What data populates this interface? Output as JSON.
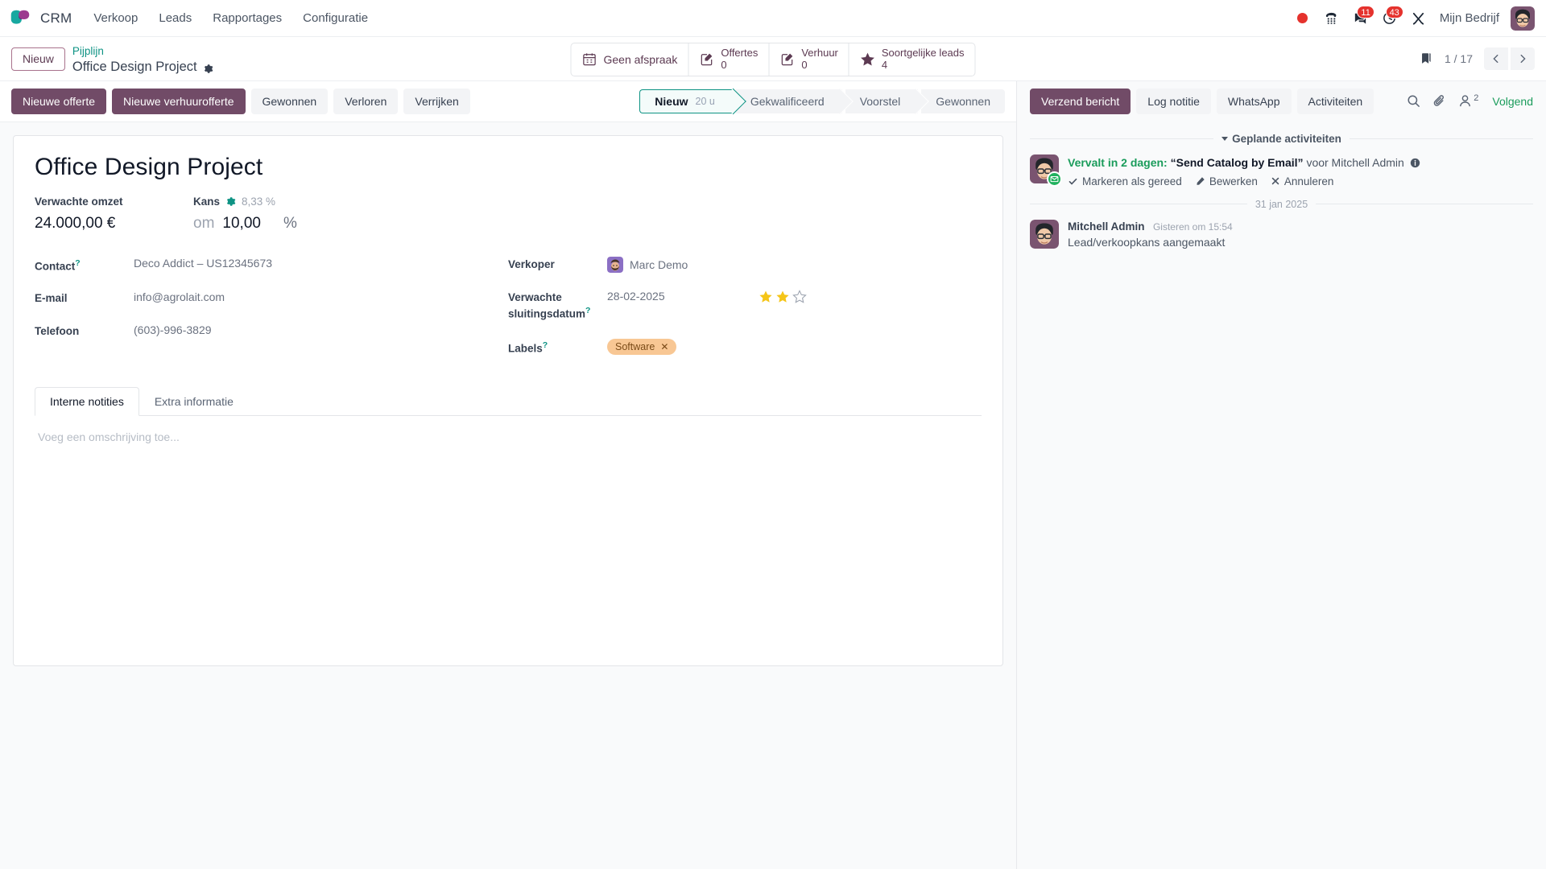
{
  "navbar": {
    "app_name": "CRM",
    "menus": [
      "Verkoop",
      "Leads",
      "Rapportages",
      "Configuratie"
    ],
    "icons": [
      "record-dot-icon",
      "phone-dialpad-icon",
      "messages-icon",
      "activities-clock-icon",
      "tools-icon"
    ],
    "messages_badge": "11",
    "activities_badge": "43",
    "company": "Mijn Bedrijf"
  },
  "control_panel": {
    "new_button": "Nieuw",
    "breadcrumb_parent": "Pijplijn",
    "breadcrumb_current": "Office Design Project",
    "stat_buttons": [
      {
        "icon": "calendar-icon",
        "label": "Geen afspraak",
        "value": ""
      },
      {
        "icon": "quotation-icon",
        "label": "Offertes",
        "value": "0"
      },
      {
        "icon": "rental-icon",
        "label": "Verhuur",
        "value": "0"
      },
      {
        "icon": "star-icon",
        "label": "Soortgelijke leads",
        "value": "4"
      }
    ],
    "pager": "1 / 17"
  },
  "form_header": {
    "buttons": [
      {
        "label": "Nieuwe offerte",
        "style": "primary"
      },
      {
        "label": "Nieuwe verhuurofferte",
        "style": "primary"
      },
      {
        "label": "Gewonnen",
        "style": "secondary"
      },
      {
        "label": "Verloren",
        "style": "secondary"
      },
      {
        "label": "Verrijken",
        "style": "secondary"
      }
    ],
    "stages": [
      {
        "label": "Nieuw",
        "extra": "20 u",
        "active": true
      },
      {
        "label": "Gekwalificeerd",
        "extra": "",
        "active": false
      },
      {
        "label": "Voorstel",
        "extra": "",
        "active": false
      },
      {
        "label": "Gewonnen",
        "extra": "",
        "active": false
      }
    ]
  },
  "record": {
    "title": "Office Design Project",
    "revenue_label": "Verwachte omzet",
    "revenue_value": "24.000,00 €",
    "probability_label": "Kans",
    "probability_auto": "8,33 %",
    "probability_at": "om",
    "probability_value": "10,00",
    "probability_unit": "%",
    "left_fields": [
      {
        "label": "Contact",
        "help": "?",
        "value": "Deco Addict – US12345673"
      },
      {
        "label": "E-mail",
        "help": "",
        "value": "info@agrolait.com"
      },
      {
        "label": "Telefoon",
        "help": "",
        "value": "(603)-996-3829"
      }
    ],
    "salesperson_label": "Verkoper",
    "salesperson_value": "Marc Demo",
    "closing_label": "Verwachte sluitingsdatum",
    "closing_help": "?",
    "closing_value": "28-02-2025",
    "priority_stars_filled": 2,
    "priority_stars_total": 3,
    "tags_label": "Labels",
    "tags_help": "?",
    "tags": [
      {
        "name": "Software",
        "color": "#f8c794"
      }
    ]
  },
  "notebook": {
    "tabs": [
      {
        "label": "Interne notities",
        "active": true
      },
      {
        "label": "Extra informatie",
        "active": false
      }
    ],
    "placeholder": "Voeg een omschrijving toe..."
  },
  "chatter": {
    "buttons": [
      {
        "label": "Verzend bericht",
        "style": "primary"
      },
      {
        "label": "Log notitie",
        "style": "secondary"
      },
      {
        "label": "WhatsApp",
        "style": "secondary"
      },
      {
        "label": "Activiteiten",
        "style": "secondary"
      }
    ],
    "tool_icons": [
      "search-icon",
      "paperclip-icon",
      "followers-icon"
    ],
    "followers_count": "2",
    "follow_label": "Volgend",
    "activities_section": "Geplande activiteiten",
    "activity": {
      "due": "Vervalt in 2 dagen:",
      "summary": "“Send Catalog by Email”",
      "assignee": "voor Mitchell Admin",
      "actions": [
        {
          "icon": "check-icon",
          "label": "Markeren als gereed"
        },
        {
          "icon": "pencil-icon",
          "label": "Bewerken"
        },
        {
          "icon": "cross-icon",
          "label": "Annuleren"
        }
      ]
    },
    "date_separator": "31 jan 2025",
    "messages": [
      {
        "author": "Mitchell Admin",
        "time": "Gisteren om 15:54",
        "body": "Lead/verkoopkans aangemaakt"
      }
    ]
  },
  "colors": {
    "primary": "#714b67",
    "accent_teal": "#0e9384",
    "badge_red": "#e5322d",
    "green": "#1a9c5b",
    "tag_orange": "#f8c794"
  }
}
